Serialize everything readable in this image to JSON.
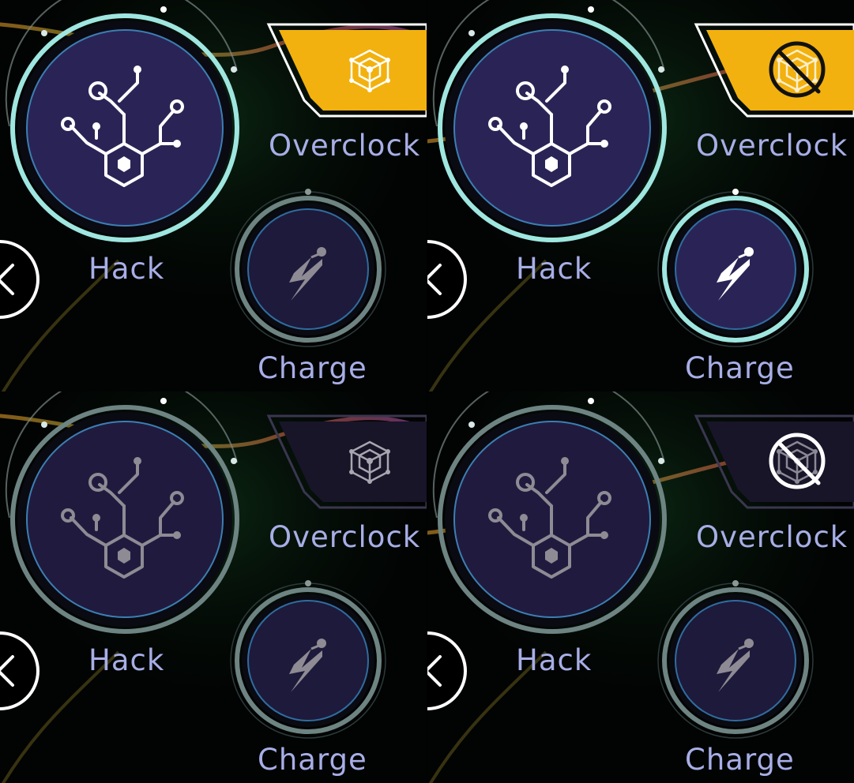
{
  "panels": [
    {
      "hack": {
        "label": "Hack",
        "state": "active"
      },
      "overclock": {
        "label": "Overclock",
        "state": "active",
        "disabled": false
      },
      "charge": {
        "label": "Charge",
        "state": "inactive"
      }
    },
    {
      "hack": {
        "label": "Hack",
        "state": "active"
      },
      "overclock": {
        "label": "Overclock",
        "state": "active",
        "disabled": true
      },
      "charge": {
        "label": "Charge",
        "state": "active"
      }
    },
    {
      "hack": {
        "label": "Hack",
        "state": "inactive"
      },
      "overclock": {
        "label": "Overclock",
        "state": "inactive",
        "disabled": false
      },
      "charge": {
        "label": "Charge",
        "state": "inactive"
      }
    },
    {
      "hack": {
        "label": "Hack",
        "state": "inactive"
      },
      "overclock": {
        "label": "Overclock",
        "state": "inactive",
        "disabled": true
      },
      "charge": {
        "label": "Charge",
        "state": "inactive"
      }
    }
  ],
  "icons": {
    "hack": "hack-tree-icon",
    "overclock": "cube-network-icon",
    "overclock_disabled": "cube-network-disabled-icon",
    "charge": "lightning-icon",
    "back": "chevron-left-icon"
  },
  "colors": {
    "label": "#a7aee6",
    "overclock_active_fill": "#f2b10e",
    "overclock_inactive_fill": "#181529",
    "button_fill": "#2a2456",
    "ring_active": "#9fe6e0",
    "ring_inactive": "#6d8482"
  }
}
